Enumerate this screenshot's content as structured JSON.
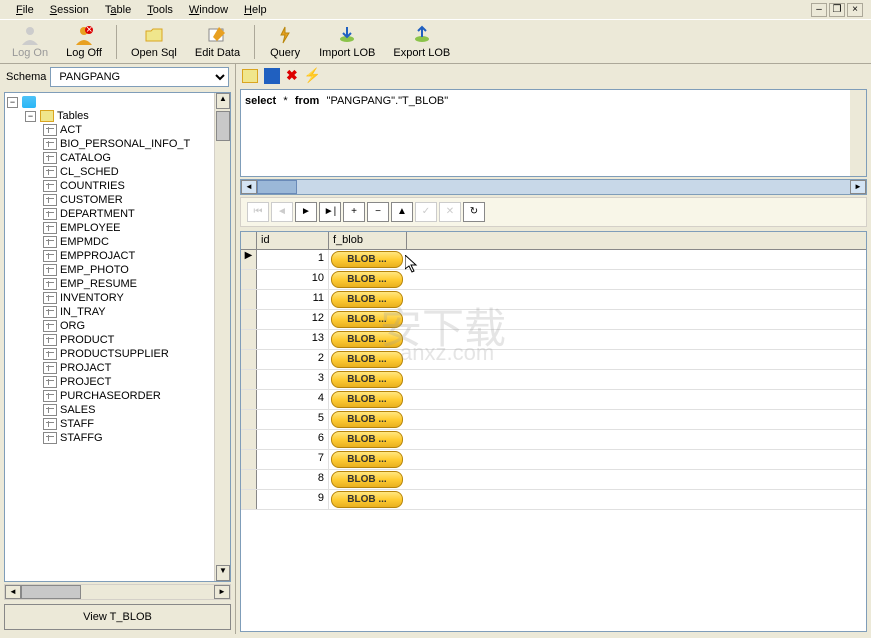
{
  "menubar": {
    "file": "File",
    "session": "Session",
    "table": "Table",
    "tools": "Tools",
    "window": "Window",
    "help": "Help"
  },
  "toolbar": {
    "logon": "Log On",
    "logoff": "Log Off",
    "opensql": "Open Sql",
    "editdata": "Edit Data",
    "query": "Query",
    "importlob": "Import LOB",
    "exportlob": "Export LOB"
  },
  "schema": {
    "label": "Schema",
    "value": "PANGPANG"
  },
  "tree": {
    "root": "Tables",
    "tables": [
      "ACT",
      "BIO_PERSONAL_INFO_T",
      "CATALOG",
      "CL_SCHED",
      "COUNTRIES",
      "CUSTOMER",
      "DEPARTMENT",
      "EMPLOYEE",
      "EMPMDC",
      "EMPPROJACT",
      "EMP_PHOTO",
      "EMP_RESUME",
      "INVENTORY",
      "IN_TRAY",
      "ORG",
      "PRODUCT",
      "PRODUCTSUPPLIER",
      "PROJACT",
      "PROJECT",
      "PURCHASEORDER",
      "SALES",
      "STAFF",
      "STAFFG"
    ]
  },
  "view_button": "View T_BLOB",
  "sql": {
    "select": "select",
    "star": "*",
    "from": "from",
    "table": "\"PANGPANG\".\"T_BLOB\""
  },
  "grid": {
    "col_id": "id",
    "col_blob": "f_blob",
    "blob_label": "BLOB ...",
    "rows": [
      {
        "id": "1"
      },
      {
        "id": "10"
      },
      {
        "id": "11"
      },
      {
        "id": "12"
      },
      {
        "id": "13"
      },
      {
        "id": "2"
      },
      {
        "id": "3"
      },
      {
        "id": "4"
      },
      {
        "id": "5"
      },
      {
        "id": "6"
      },
      {
        "id": "7"
      },
      {
        "id": "8"
      },
      {
        "id": "9"
      }
    ]
  },
  "watermark": {
    "main": "安下载",
    "sub": "anxz.com"
  }
}
